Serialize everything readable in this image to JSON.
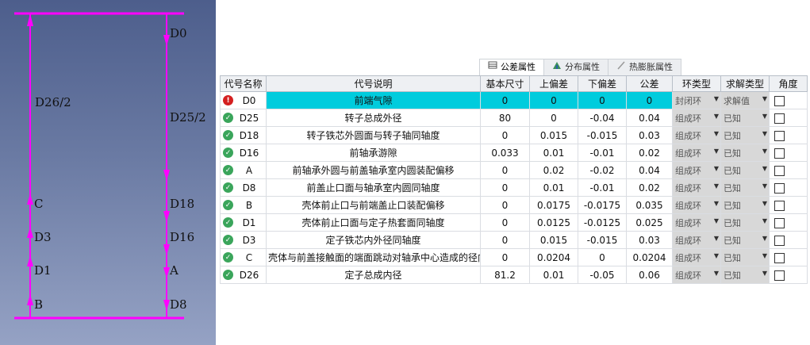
{
  "diagram": {
    "left_chain": [
      "D26/2",
      "C",
      "D3",
      "D1",
      "B"
    ],
    "right_chain": [
      "D0",
      "D25/2",
      "D18",
      "D16",
      "A",
      "D8"
    ],
    "colors": {
      "line": "#ff00ff",
      "text": "#111111"
    }
  },
  "tabs": [
    {
      "label": "公差属性",
      "icon": "tolerance-icon",
      "active": true
    },
    {
      "label": "分布属性",
      "icon": "distribution-icon",
      "active": false
    },
    {
      "label": "热膨胀属性",
      "icon": "thermal-icon",
      "active": false
    }
  ],
  "table": {
    "headers": [
      "代号名称",
      "代号说明",
      "基本尺寸",
      "上偏差",
      "下偏差",
      "公差",
      "环类型",
      "求解类型",
      "角度"
    ],
    "rows": [
      {
        "status": "error",
        "code": "D0",
        "desc": "前端气隙",
        "base": "0",
        "upper": "0",
        "lower": "0",
        "tol": "0",
        "ring": "封闭环",
        "solve": "求解值",
        "selected": true
      },
      {
        "status": "ok",
        "code": "D25",
        "desc": "转子总成外径",
        "base": "80",
        "upper": "0",
        "lower": "-0.04",
        "tol": "0.04",
        "ring": "组成环",
        "solve": "已知"
      },
      {
        "status": "ok",
        "code": "D18",
        "desc": "转子铁芯外圆面与转子轴同轴度",
        "base": "0",
        "upper": "0.015",
        "lower": "-0.015",
        "tol": "0.03",
        "ring": "组成环",
        "solve": "已知"
      },
      {
        "status": "ok",
        "code": "D16",
        "desc": "前轴承游隙",
        "base": "0.033",
        "upper": "0.01",
        "lower": "-0.01",
        "tol": "0.02",
        "ring": "组成环",
        "solve": "已知"
      },
      {
        "status": "ok",
        "code": "A",
        "desc": "前轴承外圆与前盖轴承室内圆装配偏移",
        "base": "0",
        "upper": "0.02",
        "lower": "-0.02",
        "tol": "0.04",
        "ring": "组成环",
        "solve": "已知"
      },
      {
        "status": "ok",
        "code": "D8",
        "desc": "前盖止口面与轴承室内圆同轴度",
        "base": "0",
        "upper": "0.01",
        "lower": "-0.01",
        "tol": "0.02",
        "ring": "组成环",
        "solve": "已知"
      },
      {
        "status": "ok",
        "code": "B",
        "desc": "壳体前止口与前端盖止口装配偏移",
        "base": "0",
        "upper": "0.0175",
        "lower": "-0.0175",
        "tol": "0.035",
        "ring": "组成环",
        "solve": "已知"
      },
      {
        "status": "ok",
        "code": "D1",
        "desc": "壳体前止口面与定子热套面同轴度",
        "base": "0",
        "upper": "0.0125",
        "lower": "-0.0125",
        "tol": "0.025",
        "ring": "组成环",
        "solve": "已知"
      },
      {
        "status": "ok",
        "code": "D3",
        "desc": "定子铁芯内外径同轴度",
        "base": "0",
        "upper": "0.015",
        "lower": "-0.015",
        "tol": "0.03",
        "ring": "组成环",
        "solve": "已知"
      },
      {
        "status": "ok",
        "code": "C",
        "desc": "壳体与前盖接触面的端面跳动对轴承中心造成的径向偏差",
        "base": "0",
        "upper": "0.0204",
        "lower": "0",
        "tol": "0.0204",
        "ring": "组成环",
        "solve": "已知"
      },
      {
        "status": "ok",
        "code": "D26",
        "desc": "定子总成内径",
        "base": "81.2",
        "upper": "0.01",
        "lower": "-0.05",
        "tol": "0.06",
        "ring": "组成环",
        "solve": "已知"
      }
    ]
  }
}
